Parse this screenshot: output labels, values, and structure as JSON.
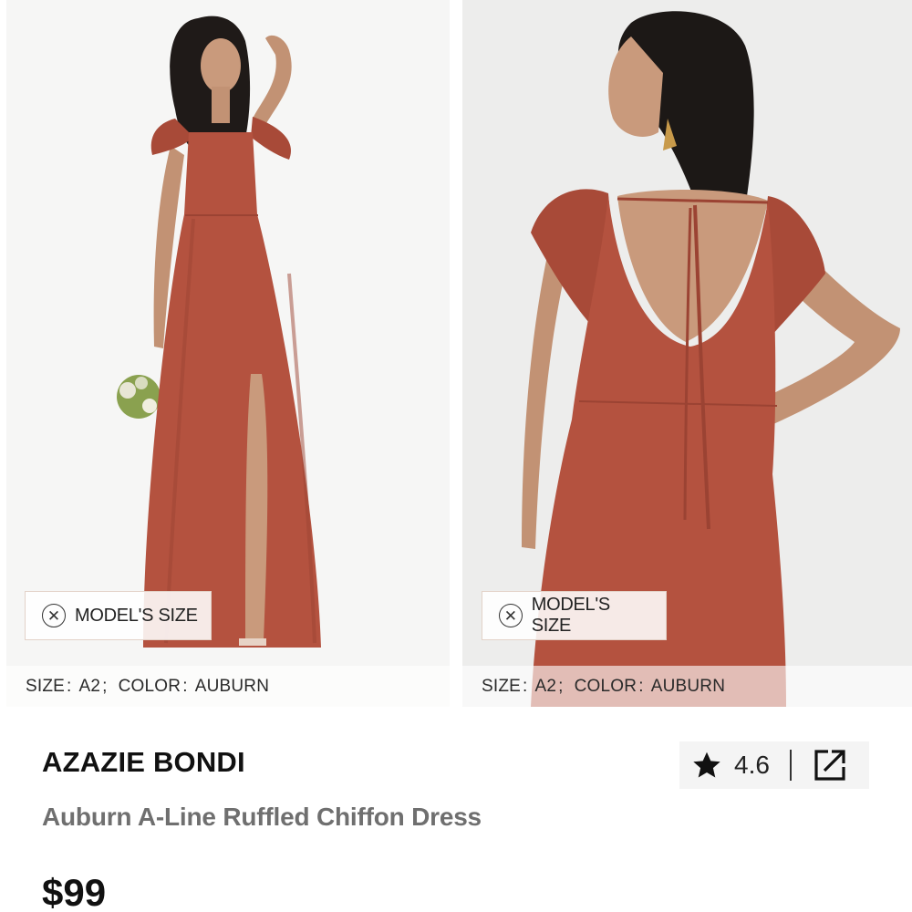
{
  "gallery": {
    "images": [
      {
        "view": "front",
        "model_size_label": "MODEL'S SIZE",
        "size_label": "SIZE",
        "size_value": "A2",
        "color_label": "COLOR",
        "color_value": "AUBURN"
      },
      {
        "view": "back",
        "model_size_label": "MODEL'S SIZE",
        "size_label": "SIZE",
        "size_value": "A2",
        "color_label": "COLOR",
        "color_value": "AUBURN"
      }
    ],
    "dress_color": "#b4523f"
  },
  "product": {
    "brand": "AZAZIE BONDI",
    "name": "Auburn A-Line Ruffled Chiffon Dress",
    "price": "$99",
    "rating": "4.6"
  },
  "icons": {
    "close": "close-circle-icon",
    "star": "star-icon",
    "share": "share-external-icon"
  }
}
